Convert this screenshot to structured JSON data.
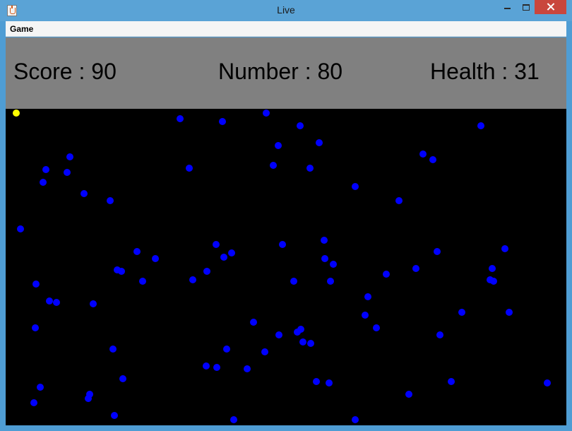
{
  "window": {
    "title": "Live"
  },
  "menu": {
    "game_label": "Game"
  },
  "hud": {
    "score_text": "Score : 90",
    "number_text": "Number : 80",
    "health_text": "Health : 31"
  },
  "colors": {
    "hud_background": "#808080",
    "field_background": "#000000",
    "player": "#ffff00",
    "enemy": "#0000ff"
  },
  "icons": {
    "app": "java-app-icon",
    "minimize": "minimize-icon",
    "maximize": "maximize-icon",
    "close": "close-icon"
  }
}
